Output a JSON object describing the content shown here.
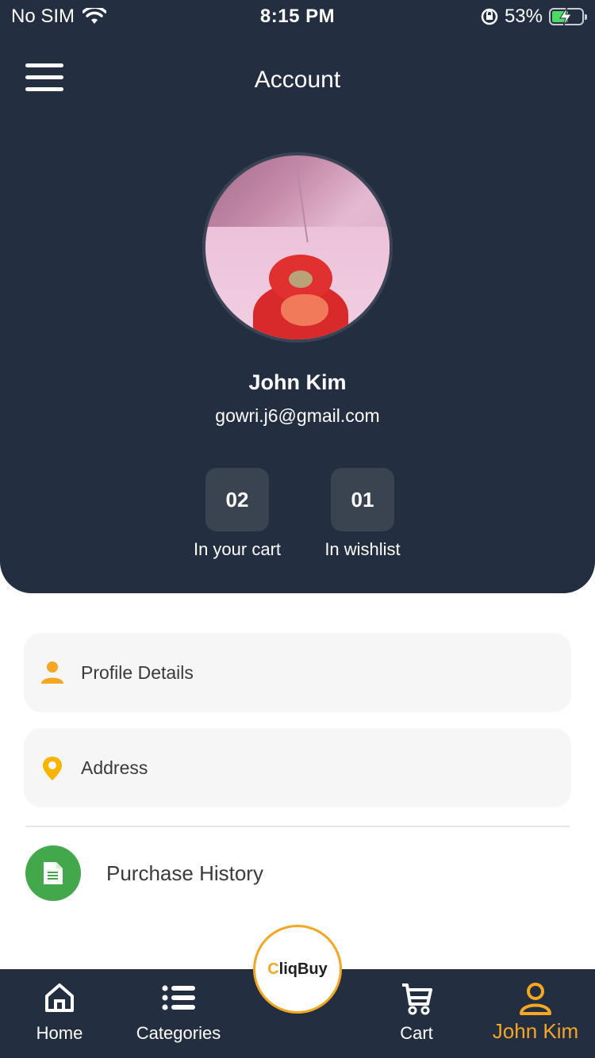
{
  "status_bar": {
    "carrier": "No SIM",
    "time": "8:15 PM",
    "battery": "53%"
  },
  "header": {
    "title": "Account"
  },
  "profile": {
    "name": "John Kim",
    "email": "gowri.j6@gmail.com"
  },
  "stats": [
    {
      "value": "02",
      "label": "In your cart"
    },
    {
      "value": "01",
      "label": "In wishlist"
    }
  ],
  "menu": [
    {
      "label": "Profile Details",
      "icon": "person-icon",
      "color": "#f5a623"
    },
    {
      "label": "Address",
      "icon": "location-pin-icon",
      "color": "#f7b500"
    }
  ],
  "purchase_history": {
    "label": "Purchase History",
    "icon": "document-icon",
    "color": "#43a84c"
  },
  "tabbar": {
    "items": [
      {
        "label": "Home",
        "icon": "home-icon"
      },
      {
        "label": "Categories",
        "icon": "list-icon"
      },
      {
        "label": "Cart",
        "icon": "cart-icon"
      },
      {
        "label": "John Kim",
        "icon": "user-icon",
        "active": true
      }
    ],
    "logo": {
      "prefix": "C",
      "rest": "liqBuy"
    }
  },
  "colors": {
    "header_bg": "#232e40",
    "accent": "#f5a623",
    "green": "#43a84c"
  }
}
